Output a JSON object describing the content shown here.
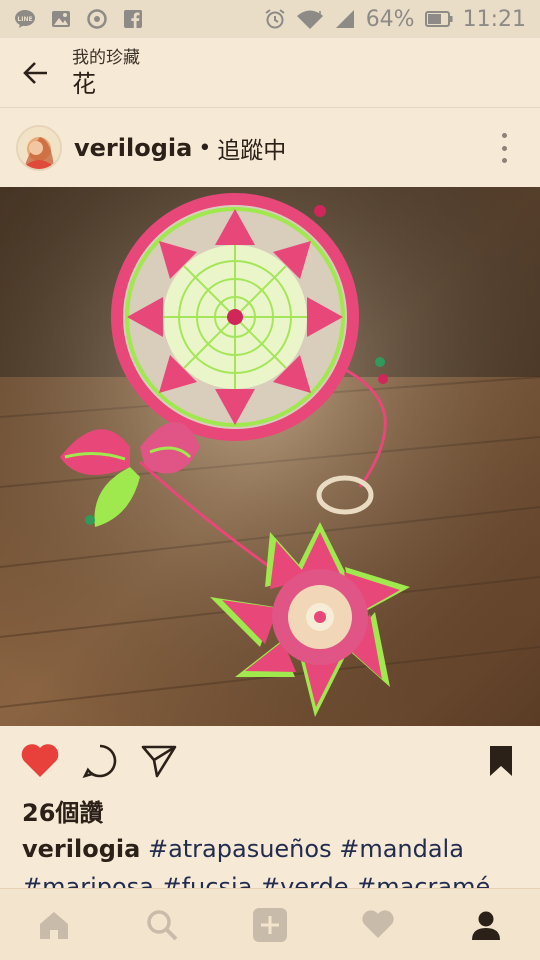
{
  "status_bar": {
    "battery_text": "64%",
    "time": "11:21",
    "left_icons": [
      "line-icon",
      "gallery-icon",
      "media-icon",
      "facebook-icon"
    ],
    "right_icons": [
      "alarm-icon",
      "wifi-icon",
      "signal-icon",
      "battery-icon"
    ]
  },
  "header": {
    "subtitle": "我的珍藏",
    "title": "花"
  },
  "post": {
    "username": "verilogia",
    "separator": "•",
    "follow_status": "追蹤中",
    "likes": "26個讚",
    "caption_user": "verilogia",
    "caption_tags_line1": "#atrapasueños #mandala",
    "caption_tags_line2": "#mariposa #fucsia #verde #macramé"
  },
  "actions": {
    "like_active_color": "#e8403a",
    "icons": [
      "heart-icon",
      "comment-icon",
      "share-icon",
      "bookmark-icon"
    ]
  },
  "bottom_nav": {
    "icons": [
      "home-icon",
      "search-icon",
      "add-icon",
      "activity-icon",
      "profile-icon"
    ]
  },
  "colors": {
    "background": "#f6ead6",
    "text": "#2b2118",
    "hashtag": "#232c4f"
  }
}
